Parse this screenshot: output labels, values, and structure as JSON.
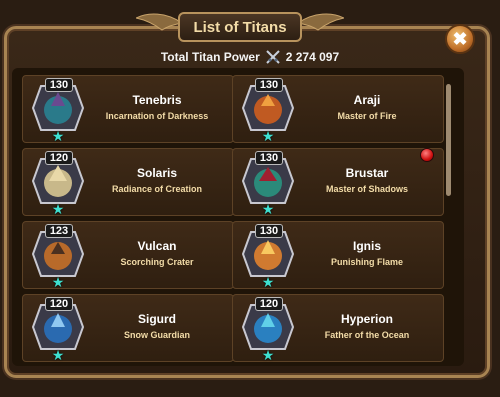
{
  "header": {
    "title": "List of Titans",
    "close_symbol": "✖"
  },
  "power": {
    "label": "Total Titan Power",
    "value": "2 274 097"
  },
  "colors": {
    "accent": "#f3dca8",
    "frame": "#a88452",
    "star": "#3ee0d0"
  },
  "titans": [
    {
      "level": "130",
      "name": "Tenebris",
      "title": "Incarnation of Darkness",
      "hue": "#2a7a8a"
    },
    {
      "level": "130",
      "name": "Araji",
      "title": "Master of Fire",
      "hue": "#c05a22"
    },
    {
      "level": "120",
      "name": "Solaris",
      "title": "Radiance of Creation",
      "hue": "#c8b88a"
    },
    {
      "level": "130",
      "name": "Brustar",
      "title": "Master of Shadows",
      "hue": "#2b8a7a"
    },
    {
      "level": "123",
      "name": "Vulcan",
      "title": "Scorching Crater",
      "hue": "#b86a2a"
    },
    {
      "level": "130",
      "name": "Ignis",
      "title": "Punishing Flame",
      "hue": "#d07a30"
    },
    {
      "level": "120",
      "name": "Sigurd",
      "title": "Snow Guardian",
      "hue": "#2a6ab0"
    },
    {
      "level": "120",
      "name": "Hyperion",
      "title": "Father of the Ocean",
      "hue": "#2a80c0"
    }
  ]
}
